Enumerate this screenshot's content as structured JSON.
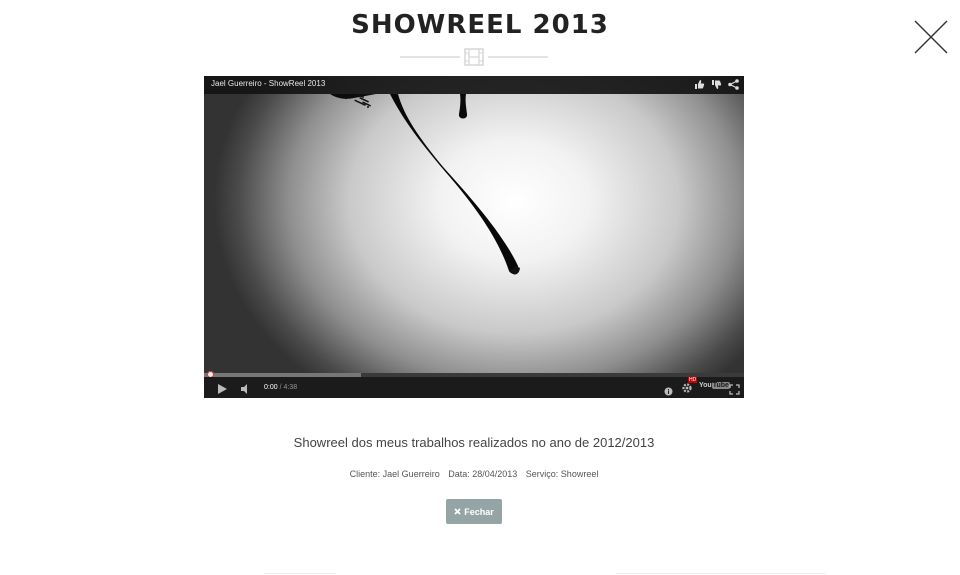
{
  "modal": {
    "title": "SHOWREEL 2013",
    "close_icon": "close-icon",
    "divider_icon": "film-icon"
  },
  "player": {
    "video_title": "Jael Guerreiro - ShowReel 2013",
    "top_icons": [
      "thumbs-up-icon",
      "thumbs-down-icon",
      "share-icon"
    ],
    "current_time": "0:00",
    "separator": " / ",
    "duration": "4:38",
    "progress_loaded": 0.29,
    "controls_icons": [
      "play-icon",
      "volume-icon",
      "info-icon",
      "settings-icon",
      "youtube-logo",
      "fullscreen-icon"
    ],
    "hd_badge": "HD",
    "logo_you": "You",
    "logo_tube": "Tube"
  },
  "details": {
    "description": "Showreel dos meus trabalhos realizados no ano de 2012/2013",
    "client": "Cliente: Jael Guerreiro",
    "date": "Data: 28/04/2013",
    "service": "Serviço: Showreel"
  },
  "actions": {
    "close_label": "Fechar",
    "close_button_icon": "x-icon"
  },
  "colors": {
    "button_bg": "#95a5a6",
    "title": "#222222"
  }
}
